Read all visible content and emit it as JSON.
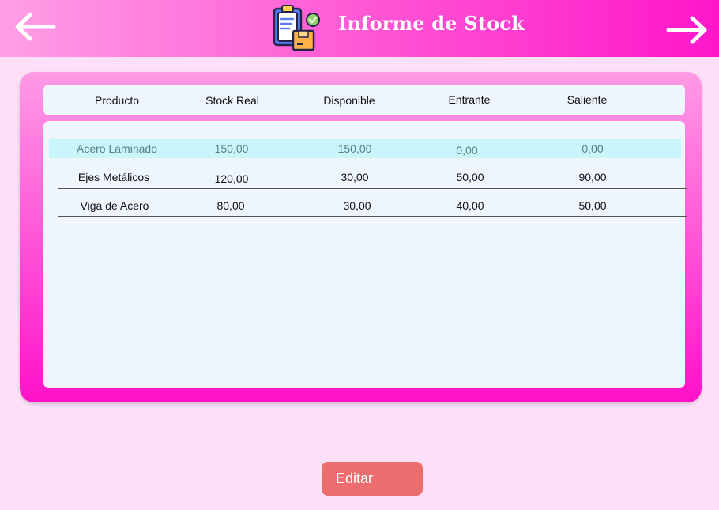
{
  "header": {
    "title": "Informe de Stock",
    "back_icon": "arrow-left-icon",
    "forward_icon": "arrow-right-icon",
    "logo_icon": "clipboard-box-icon"
  },
  "table": {
    "columns": [
      "Producto",
      "Stock Real",
      "Disponible",
      "Entrante",
      "Saliente"
    ],
    "rows": [
      {
        "producto": "Acero Laminado",
        "stock_real": "150,00",
        "disponible": "150,00",
        "entrante": "0,00",
        "saliente": "0,00",
        "selected": true
      },
      {
        "producto": "Ejes Metálicos",
        "stock_real": "120,00",
        "disponible": "30,00",
        "entrante": "50,00",
        "saliente": "90,00",
        "selected": false
      },
      {
        "producto": "Viga de Acero",
        "stock_real": "80,00",
        "disponible": "30,00",
        "entrante": "40,00",
        "saliente": "50,00",
        "selected": false
      }
    ]
  },
  "actions": {
    "edit_label": "Editar"
  },
  "colors": {
    "header_gradient_start": "#ff9fe6",
    "header_gradient_end": "#ff16c9",
    "page_background": "#fde0f7",
    "card_background": "#eef5fd",
    "selected_row": "#c9f6fb",
    "edit_button": "#ec6d6d"
  }
}
